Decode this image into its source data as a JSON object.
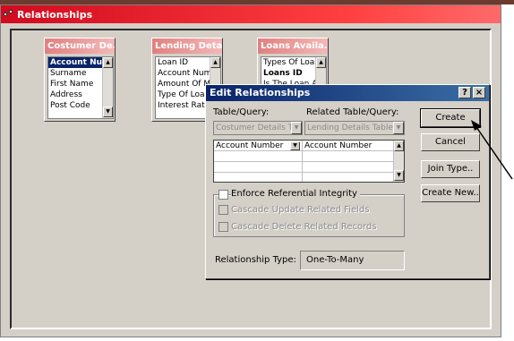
{
  "window": {
    "title": "Relationships"
  },
  "tables": [
    {
      "title": "Costumer De...",
      "fields": [
        "Account Numl",
        "Surname",
        "First Name",
        "Address",
        "Post Code"
      ]
    },
    {
      "title": "Lending Detai...",
      "fields": [
        "Loan ID",
        "Account Numb",
        "Amount Of Mc",
        "Type Of Loan",
        "Interest Rate"
      ]
    },
    {
      "title": "Loans Availa...",
      "fields": [
        "Types Of Loar",
        "Loans ID",
        "Is The Loan A"
      ]
    }
  ],
  "dialog": {
    "title": "Edit Relationships",
    "help_btn": "?",
    "close_btn": "×",
    "table_query_label": "Table/Query:",
    "related_label": "Related Table/Query:",
    "table_value": "Costumer Details Ta",
    "related_value": "Lending Details Table",
    "grid": {
      "left_field": "Account Number",
      "right_field": "Account Number"
    },
    "enforce_label": "Enforce Referential Integrity",
    "cascade_update_label": "Cascade Update Related Fields",
    "cascade_delete_label": "Cascade Delete Related Records",
    "rel_type_label": "Relationship Type:",
    "rel_type_value": "One-To-Many",
    "buttons": {
      "create": "Create",
      "cancel": "Cancel",
      "join_type": "Join Type..",
      "create_new": "Create New.."
    }
  },
  "icons": {
    "scroll_up": "▲",
    "scroll_down": "▼",
    "dropdown": "▼"
  }
}
